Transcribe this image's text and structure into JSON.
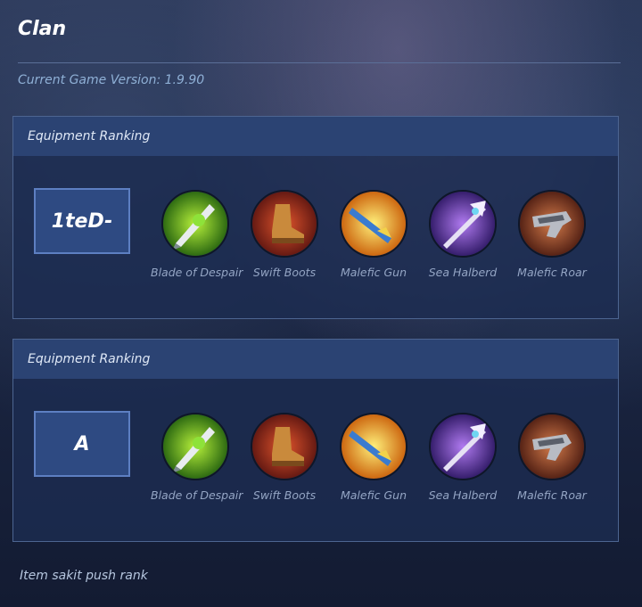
{
  "page": {
    "title": "Clan"
  },
  "version": {
    "text": "Current Game Version: 1.9.90"
  },
  "panels": [
    {
      "header": "Equipment Ranking",
      "rank": "1teD-",
      "items": [
        {
          "label": "Blade of Despair",
          "icon": "blade-of-despair-icon"
        },
        {
          "label": "Swift Boots",
          "icon": "swift-boots-icon"
        },
        {
          "label": "Malefic Gun",
          "icon": "malefic-gun-icon"
        },
        {
          "label": "Sea Halberd",
          "icon": "sea-halberd-icon"
        },
        {
          "label": "Malefic Roar",
          "icon": "malefic-roar-icon"
        }
      ]
    },
    {
      "header": "Equipment Ranking",
      "rank": "A",
      "items": [
        {
          "label": "Blade of Despair",
          "icon": "blade-of-despair-icon"
        },
        {
          "label": "Swift Boots",
          "icon": "swift-boots-icon"
        },
        {
          "label": "Malefic Gun",
          "icon": "malefic-gun-icon"
        },
        {
          "label": "Sea Halberd",
          "icon": "sea-halberd-icon"
        },
        {
          "label": "Malefic Roar",
          "icon": "malefic-roar-icon"
        }
      ]
    }
  ],
  "footer": {
    "text": "Item sakit push rank"
  }
}
